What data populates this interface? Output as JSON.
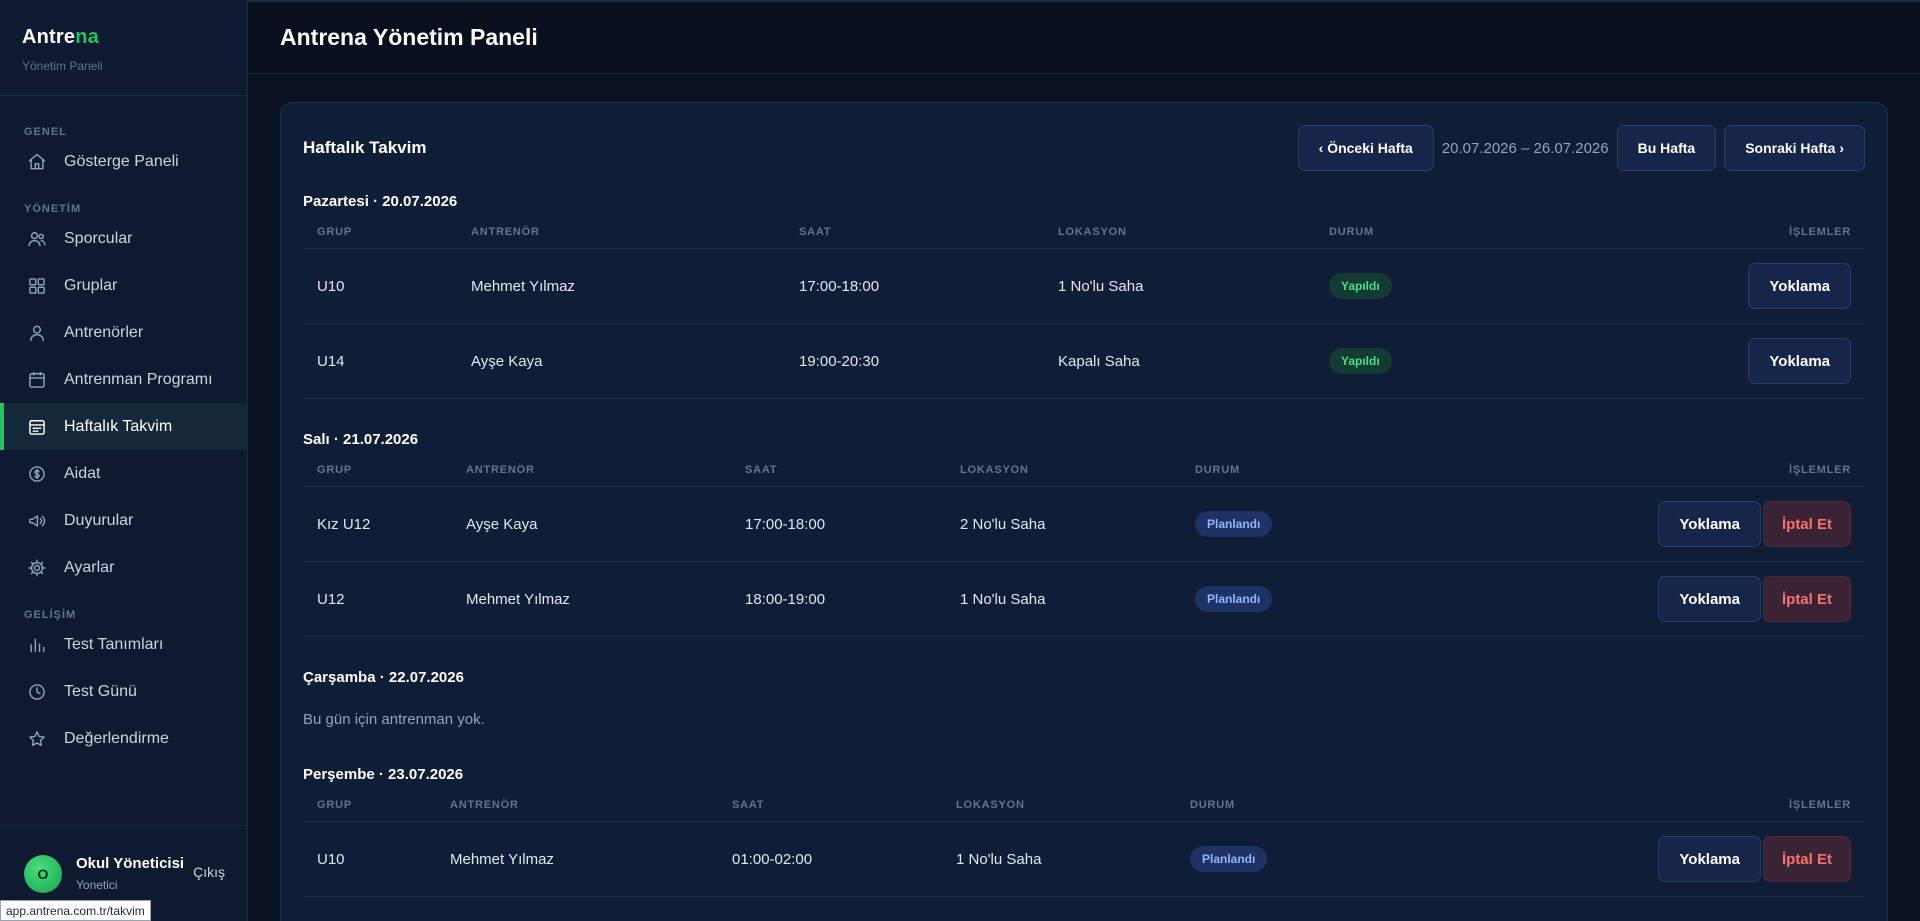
{
  "sidebar": {
    "brand_main": "Antre",
    "brand_accent": "na",
    "brand_sub": "Yönetim Paneli",
    "sections": {
      "genel": "GENEL",
      "yonetim": "YÖNETİM",
      "gelisim": "GELİŞİM"
    },
    "items": [
      {
        "label": "Gösterge Paneli",
        "icon": "home-icon"
      },
      {
        "label": "Sporcular",
        "icon": "users-icon"
      },
      {
        "label": "Gruplar",
        "icon": "grid-icon"
      },
      {
        "label": "Antrenörler",
        "icon": "user-icon"
      },
      {
        "label": "Antrenman Programı",
        "icon": "calendar-icon"
      },
      {
        "label": "Haftalık Takvim",
        "icon": "calendar-week-icon"
      },
      {
        "label": "Aidat",
        "icon": "coin-icon"
      },
      {
        "label": "Duyurular",
        "icon": "megaphone-icon"
      },
      {
        "label": "Ayarlar",
        "icon": "gear-icon"
      },
      {
        "label": "Test Tanımları",
        "icon": "bar-chart-icon"
      },
      {
        "label": "Test Günü",
        "icon": "clock-icon"
      },
      {
        "label": "Değerlendirme",
        "icon": "star-icon"
      }
    ],
    "user": {
      "initial": "O",
      "name": "Okul Yöneticisi",
      "role": "Yonetici",
      "logout": "Çıkış"
    }
  },
  "status_url": "app.antrena.com.tr/takvim",
  "header": {
    "title": "Antrena Yönetim Paneli"
  },
  "calendar": {
    "title": "Haftalık Takvim",
    "prev": "‹ Önceki Hafta",
    "range": "20.07.2026 – 26.07.2026",
    "this_week": "Bu Hafta",
    "next": "Sonraki Hafta ›",
    "columns": {
      "group": "GRUP",
      "coach": "ANTRENÖR",
      "time": "SAAT",
      "location": "LOKASYON",
      "status": "DURUM",
      "actions": "İŞLEMLER"
    },
    "attendance_label": "Yoklama",
    "cancel_label": "İptal Et",
    "empty_text": "Bu gün için antrenman yok.",
    "days": [
      {
        "title": "Pazartesi · 20.07.2026",
        "rows": [
          {
            "group": "U10",
            "coach": "Mehmet Yılmaz",
            "time": "17:00-18:00",
            "location": "1 No'lu Saha",
            "status": "Yapıldı"
          },
          {
            "group": "U14",
            "coach": "Ayşe Kaya",
            "time": "19:00-20:30",
            "location": "Kapalı Saha",
            "status": "Yapıldı"
          }
        ]
      },
      {
        "title": "Salı · 21.07.2026",
        "rows": [
          {
            "group": "Kız U12",
            "coach": "Ayşe Kaya",
            "time": "17:00-18:00",
            "location": "2 No'lu Saha",
            "status": "Planlandı"
          },
          {
            "group": "U12",
            "coach": "Mehmet Yılmaz",
            "time": "18:00-19:00",
            "location": "1 No'lu Saha",
            "status": "Planlandı"
          }
        ]
      },
      {
        "title": "Çarşamba · 22.07.2026",
        "rows": []
      },
      {
        "title": "Perşembe · 23.07.2026",
        "rows": [
          {
            "group": "U10",
            "coach": "Mehmet Yılmaz",
            "time": "01:00-02:00",
            "location": "1 No'lu Saha",
            "status": "Planlandı"
          }
        ]
      }
    ]
  }
}
